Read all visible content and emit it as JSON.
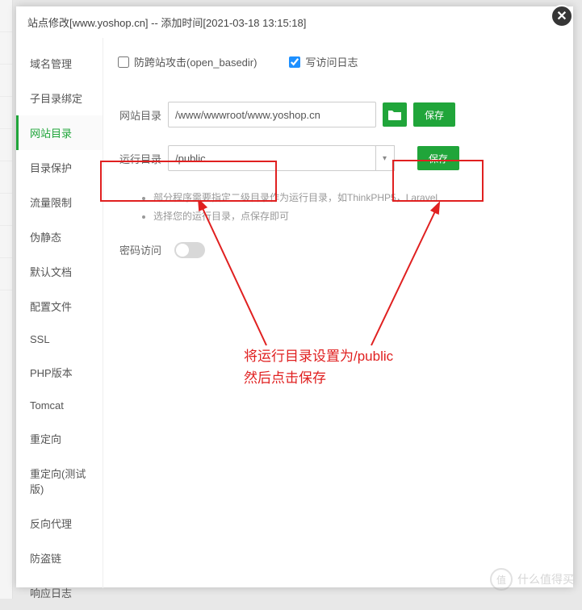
{
  "modal": {
    "title": "站点修改[www.yoshop.cn] -- 添加时间[2021-03-18 13:15:18]"
  },
  "sidebar": {
    "items": [
      {
        "label": "域名管理"
      },
      {
        "label": "子目录绑定"
      },
      {
        "label": "网站目录"
      },
      {
        "label": "目录保护"
      },
      {
        "label": "流量限制"
      },
      {
        "label": "伪静态"
      },
      {
        "label": "默认文档"
      },
      {
        "label": "配置文件"
      },
      {
        "label": "SSL"
      },
      {
        "label": "PHP版本"
      },
      {
        "label": "Tomcat"
      },
      {
        "label": "重定向"
      },
      {
        "label": "重定向(测试版)"
      },
      {
        "label": "反向代理"
      },
      {
        "label": "防盗链"
      },
      {
        "label": "响应日志"
      }
    ],
    "active_index": 2
  },
  "content": {
    "open_basedir_label": "防跨站攻击(open_basedir)",
    "open_basedir_checked": false,
    "access_log_label": "写访问日志",
    "access_log_checked": true,
    "site_dir_label": "网站目录",
    "site_dir_value": "/www/wwwroot/www.yoshop.cn",
    "run_dir_label": "运行目录",
    "run_dir_value": "/public",
    "save_label": "保存",
    "hint1": "部分程序需要指定二级目录作为运行目录，如ThinkPHP5，Laravel",
    "hint2": "选择您的运行目录，点保存即可",
    "password_label": "密码访问",
    "password_on": false
  },
  "annotation": {
    "line1": "将运行目录设置为/public",
    "line2": "然后点击保存"
  },
  "watermark": {
    "symbol": "值",
    "text": "什么值得买"
  }
}
